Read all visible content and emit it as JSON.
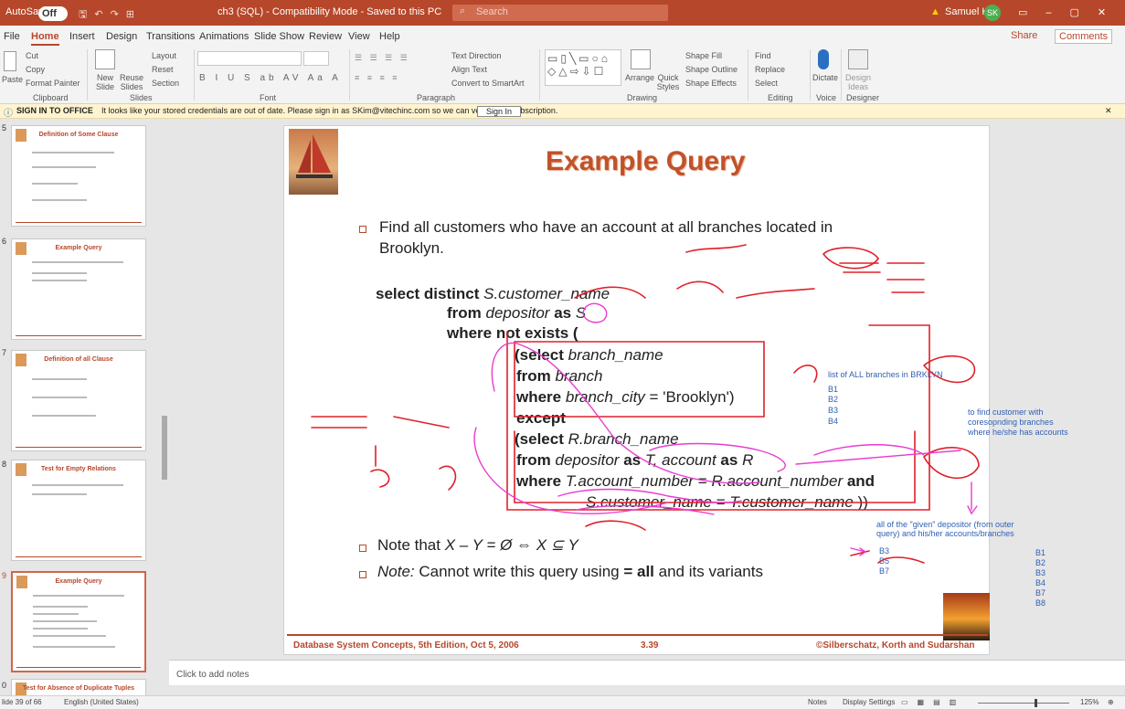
{
  "titlebar": {
    "autosave": "AutoSave",
    "toggle": "Off",
    "doc_title": "ch3 (SQL) - Compatibility Mode - Saved to this PC",
    "search": "Search",
    "user_name": "Samuel Kim",
    "user_initials": "SK"
  },
  "menu": [
    "File",
    "Home",
    "Insert",
    "Design",
    "Transitions",
    "Animations",
    "Slide Show",
    "Review",
    "View",
    "Help"
  ],
  "menu_right": {
    "share": "Share",
    "comments": "Comments"
  },
  "ribbon": {
    "clipboard": {
      "paste": "Paste",
      "cut": "Cut",
      "copy": "Copy",
      "format_painter": "Format Painter",
      "label": "Clipboard"
    },
    "slides": {
      "new_slide": "New Slide",
      "reuse": "Reuse Slides",
      "layout": "Layout",
      "reset": "Reset",
      "section": "Section",
      "label": "Slides"
    },
    "font": {
      "label": "Font"
    },
    "paragraph": {
      "text_direction": "Text Direction",
      "align_text": "Align Text",
      "convert": "Convert to SmartArt",
      "label": "Paragraph"
    },
    "drawing": {
      "arrange": "Arrange",
      "quick_styles": "Quick Styles",
      "shape_fill": "Shape Fill",
      "shape_outline": "Shape Outline",
      "shape_effects": "Shape Effects",
      "label": "Drawing"
    },
    "editing": {
      "find": "Find",
      "replace": "Replace",
      "select": "Select",
      "label": "Editing"
    },
    "voice": {
      "dictate": "Dictate",
      "label": "Voice"
    },
    "designer": {
      "ideas": "Design Ideas",
      "label": "Designer"
    }
  },
  "message": {
    "title": "SIGN IN TO OFFICE",
    "text": "It looks like your stored credentials are out of date. Please sign in as SKim@vitechinc.com so we can verify your subscription.",
    "button": "Sign In"
  },
  "thumbnails": [
    {
      "num": "5",
      "title": "Definition of  Some Clause"
    },
    {
      "num": "6",
      "title": "Example Query"
    },
    {
      "num": "7",
      "title": "Definition of all Clause"
    },
    {
      "num": "8",
      "title": "Test for Empty Relations"
    },
    {
      "num": "9",
      "title": "Example Query"
    },
    {
      "num": "0",
      "title": "Test for Absence of Duplicate Tuples"
    }
  ],
  "slide": {
    "title": "Example Query",
    "bullet1": "Find all customers who have an account at all branches located in",
    "bullet1b": "Brooklyn.",
    "sql": {
      "l1a": "select distinct",
      "l1b": "S.customer_name",
      "l2a": "from",
      "l2b": "depositor",
      "l2c": "as",
      "l2d": "S",
      "l3": "where not exists (",
      "l4a": "(select",
      "l4b": "branch_name",
      "l5a": "from",
      "l5b": "branch",
      "l6a": "where",
      "l6b": "branch_city",
      "l6c": "= 'Brooklyn')",
      "l7": "except",
      "l8a": "(select",
      "l8b": "R.branch_name",
      "l9a": "from",
      "l9b": "depositor",
      "l9c": "as",
      "l9d": "T,",
      "l9e": "account",
      "l9f": "as",
      "l9g": "R",
      "l10a": "where",
      "l10b": "T.account_number",
      "l10c": "=",
      "l10d": "R.account_number",
      "l10e": "and",
      "l11a": "S.customer_name",
      "l11b": "=",
      "l11c": "T.customer_name",
      "l11d": "))"
    },
    "note1a": "Note that",
    "note1b": "X – Y = Ø  ⇔  X ⊆ Y",
    "note2a": "Note:",
    "note2b": "Cannot write this query using",
    "note2c": "= all",
    "note2d": "and its variants",
    "footer_left": "Database System Concepts, 5th Edition, Oct 5, 2006",
    "footer_mid": "3.39",
    "footer_right": "©Silberschatz, Korth and Sudarshan",
    "annotations": {
      "a1": "list of ALL branches in BRKLYN",
      "b1": "B1",
      "b2": "B2",
      "b3": "B3",
      "b4": "B4",
      "a2": "to find customer with",
      "a3": "coresopnding branches",
      "a4": "where he/she has accounts",
      "a5": "all of the \"given\" depositor (from outer",
      "a6": "query) and his/her accounts/branches",
      "s1": "B3",
      "s2": "B5",
      "s3": "B7",
      "j1": "B1",
      "j2": "B2",
      "j3": "B3",
      "j4": "B4",
      "j5": "B7",
      "j6": "B8"
    }
  },
  "notes_placeholder": "Click to add notes",
  "status": {
    "slide": "lide 39 of 66",
    "language": "English (United States)",
    "notes": "Notes",
    "display": "Display Settings",
    "zoom": "125%"
  }
}
